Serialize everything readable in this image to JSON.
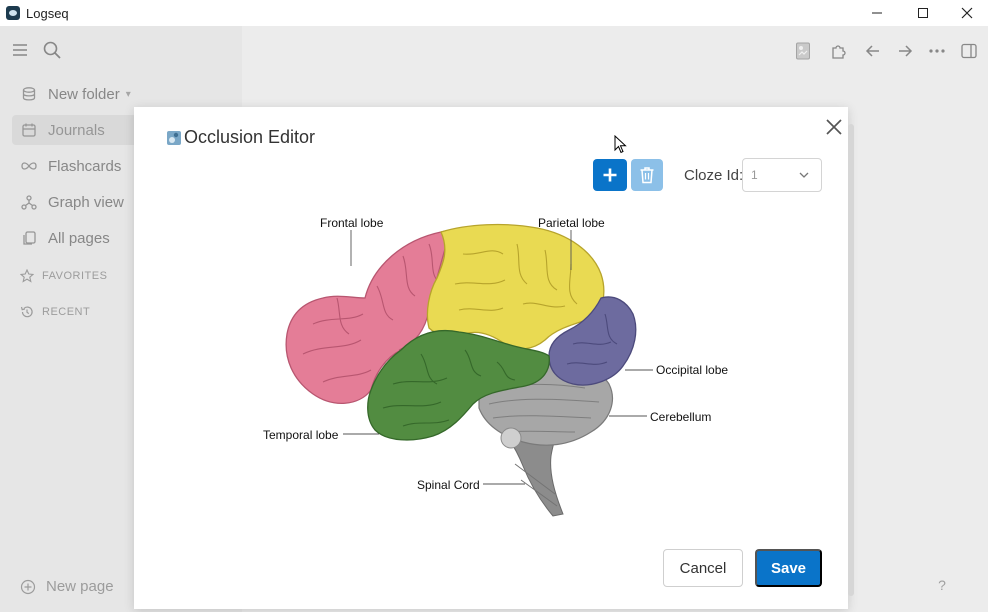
{
  "window": {
    "title": "Logseq"
  },
  "sidebar": {
    "graph_name": "New folder",
    "items": [
      {
        "label": "Journals",
        "icon": "calendar-icon",
        "active": true
      },
      {
        "label": "Flashcards",
        "icon": "infinity-icon",
        "active": false
      },
      {
        "label": "Graph view",
        "icon": "graph-icon",
        "active": false
      },
      {
        "label": "All pages",
        "icon": "pages-icon",
        "active": false
      }
    ],
    "favorites_label": "FAVORITES",
    "recent_label": "RECENT",
    "new_page_label": "New page"
  },
  "modal": {
    "title": "Occlusion Editor",
    "cloze_label": "Cloze Id:",
    "cloze_value": "1",
    "cancel_label": "Cancel",
    "save_label": "Save"
  },
  "image": {
    "labels": {
      "frontal": "Frontal lobe",
      "parietal": "Parietal lobe",
      "occipital": "Occipital lobe",
      "cerebellum": "Cerebellum",
      "temporal": "Temporal lobe",
      "spinal": "Spinal Cord"
    }
  },
  "help_label": "?",
  "colors": {
    "accent": "#0a74c9",
    "accent_light": "#8cc0e8",
    "frontal": "#e27b95",
    "parietal": "#e8d64a",
    "temporal": "#4f8a3e",
    "occipital": "#6c6a9e",
    "cerebellum": "#9a9a9a"
  }
}
